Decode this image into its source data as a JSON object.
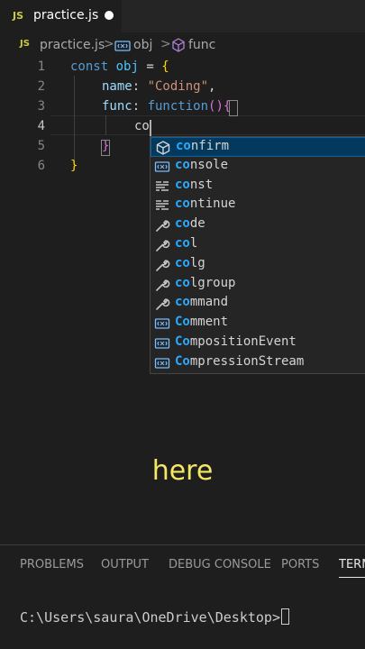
{
  "tab": {
    "badge": "JS",
    "title": "practice.js"
  },
  "breadcrumb": {
    "badge": "JS",
    "file": "practice.js",
    "separator": ">",
    "symbol1": "obj",
    "symbol2": "func"
  },
  "editor": {
    "line_numbers": [
      "1",
      "2",
      "3",
      "4",
      "5",
      "6"
    ],
    "line1": {
      "kw": "const",
      "var": "obj",
      "eq": " = ",
      "brace": "{"
    },
    "line2": {
      "prop": "name",
      "colon": ": ",
      "str": "\"Coding\"",
      "comma": ","
    },
    "line3": {
      "prop": "func",
      "colon": ": ",
      "kw": "function",
      "parens": "()",
      "brace": "{"
    },
    "line4": {
      "typed": "co"
    },
    "line5": {
      "brace": "}"
    },
    "line6": {
      "brace": "}"
    }
  },
  "suggestions": [
    {
      "match": "co",
      "rest": "nfirm",
      "icon": "cube-icon",
      "selected": true
    },
    {
      "match": "co",
      "rest": "nsole",
      "icon": "variable-icon"
    },
    {
      "match": "co",
      "rest": "nst",
      "icon": "keyword-icon"
    },
    {
      "match": "co",
      "rest": "ntinue",
      "icon": "keyword-icon"
    },
    {
      "match": "co",
      "rest": "de",
      "icon": "wrench-icon"
    },
    {
      "match": "co",
      "rest": "l",
      "icon": "wrench-icon"
    },
    {
      "match": "co",
      "rest": "lg",
      "icon": "wrench-icon"
    },
    {
      "match": "co",
      "rest": "lgroup",
      "icon": "wrench-icon"
    },
    {
      "match": "co",
      "rest": "mmand",
      "icon": "wrench-icon"
    },
    {
      "match": "Co",
      "rest": "mment",
      "icon": "variable-icon"
    },
    {
      "match": "Co",
      "rest": "mpositionEvent",
      "icon": "variable-icon"
    },
    {
      "match": "Co",
      "rest": "mpressionStream",
      "icon": "variable-icon"
    }
  ],
  "caption": "here",
  "panel": {
    "tabs": [
      "PROBLEMS",
      "OUTPUT",
      "DEBUG CONSOLE",
      "PORTS",
      "TERMINAL"
    ],
    "active_tab": "TERMINAL",
    "terminal_prompt": "C:\\Users\\saura\\OneDrive\\Desktop>"
  },
  "colors": {
    "accent": "#0e639c",
    "match": "#2aaaff",
    "caption": "#f5e663"
  }
}
